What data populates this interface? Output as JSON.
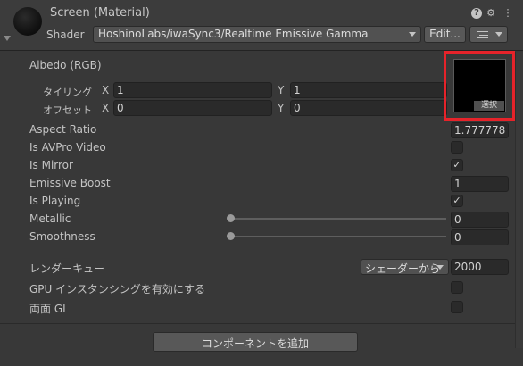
{
  "header": {
    "title": "Screen (Material)",
    "shader_label": "Shader",
    "shader_value": "HoshinoLabs/iwaSync3/Realtime Emissive Gamma",
    "edit_label": "Edit...",
    "icons": [
      "help-icon",
      "settings-icon",
      "menu-icon"
    ]
  },
  "albedo": {
    "label": "Albedo (RGB)",
    "tiling_label": "タイリング",
    "offset_label": "オフセット",
    "x_label": "X",
    "y_label": "Y",
    "tiling_x": "1",
    "tiling_y": "1",
    "offset_x": "0",
    "offset_y": "0",
    "select_label": "選択"
  },
  "properties": {
    "aspect_ratio": {
      "label": "Aspect Ratio",
      "value": "1.777778"
    },
    "is_avpro": {
      "label": "Is AVPro Video",
      "checked": false
    },
    "is_mirror": {
      "label": "Is Mirror",
      "checked": true,
      "mark": "✓"
    },
    "emissive_boost": {
      "label": "Emissive Boost",
      "value": "1"
    },
    "is_playing": {
      "label": "Is Playing",
      "checked": true,
      "mark": "✓"
    },
    "metallic": {
      "label": "Metallic",
      "value": "0",
      "slider_fraction": 0
    },
    "smoothness": {
      "label": "Smoothness",
      "value": "0",
      "slider_fraction": 0
    }
  },
  "render": {
    "queue_label": "レンダーキュー",
    "queue_mode": "シェーダーから",
    "queue_value": "2000",
    "gpu_instancing_label": "GPU インスタンシングを有効にする",
    "double_sided_gi_label": "両面 GI"
  },
  "footer": {
    "add_component_label": "コンポーネントを追加"
  },
  "colors": {
    "highlight": "#e6232a",
    "background": "#383838",
    "field": "#2a2a2a"
  }
}
